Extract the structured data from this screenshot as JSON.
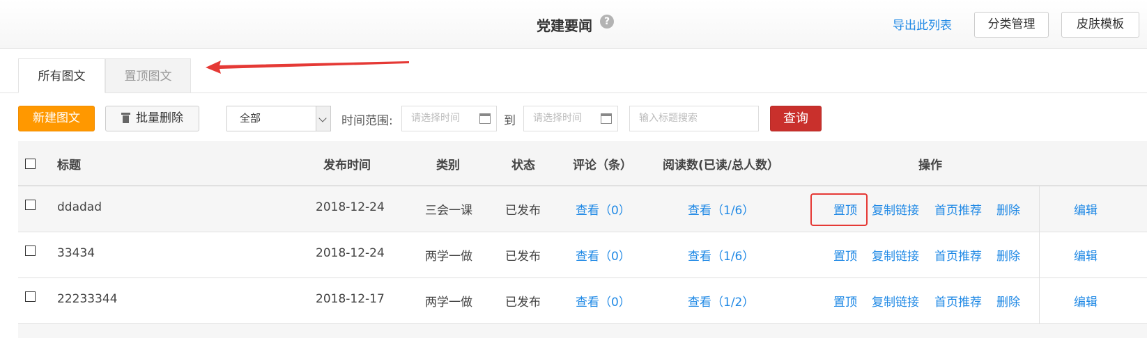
{
  "header": {
    "title": "党建要闻",
    "help_glyph": "?",
    "export_label": "导出此列表",
    "category_button": "分类管理",
    "skin_button": "皮肤模板"
  },
  "tabs": [
    {
      "label": "所有图文",
      "active": true
    },
    {
      "label": "置顶图文",
      "active": false
    }
  ],
  "toolbar": {
    "new_label": "新建图文",
    "batch_delete_label": "批量删除",
    "category_select_value": "全部",
    "time_range_label": "时间范围:",
    "date_placeholder": "请选择时间",
    "to_label": "到",
    "search_placeholder": "输入标题搜索",
    "query_label": "查询"
  },
  "table": {
    "headers": {
      "title": "标题",
      "publish_time": "发布时间",
      "category": "类别",
      "status": "状态",
      "comments": "评论（条）",
      "reads": "阅读数(已读/总人数）",
      "actions": "操作"
    },
    "action_labels": {
      "pin": "置顶",
      "copy_link": "复制链接",
      "recommend": "首页推荐",
      "delete": "删除",
      "edit": "编辑"
    },
    "rows": [
      {
        "title": "ddadad",
        "date": "2018-12-24",
        "category": "三会一课",
        "status": "已发布",
        "comments": "查看（0）",
        "reads": "查看（1/6）"
      },
      {
        "title": "33434",
        "date": "2018-12-24",
        "category": "两学一做",
        "status": "已发布",
        "comments": "查看（0）",
        "reads": "查看（1/6）"
      },
      {
        "title": "22233344",
        "date": "2018-12-17",
        "category": "两学一做",
        "status": "已发布",
        "comments": "查看（0）",
        "reads": "查看（1/2）"
      }
    ]
  },
  "colors": {
    "accent_blue": "#1e88e5",
    "new_button_orange": "#ff9800",
    "query_button_red": "#c9302c",
    "annotation_red": "#e53935"
  },
  "icons": [
    "help-icon",
    "trash-icon",
    "calendar-icon",
    "chevron-down-icon",
    "annotation-arrow"
  ]
}
